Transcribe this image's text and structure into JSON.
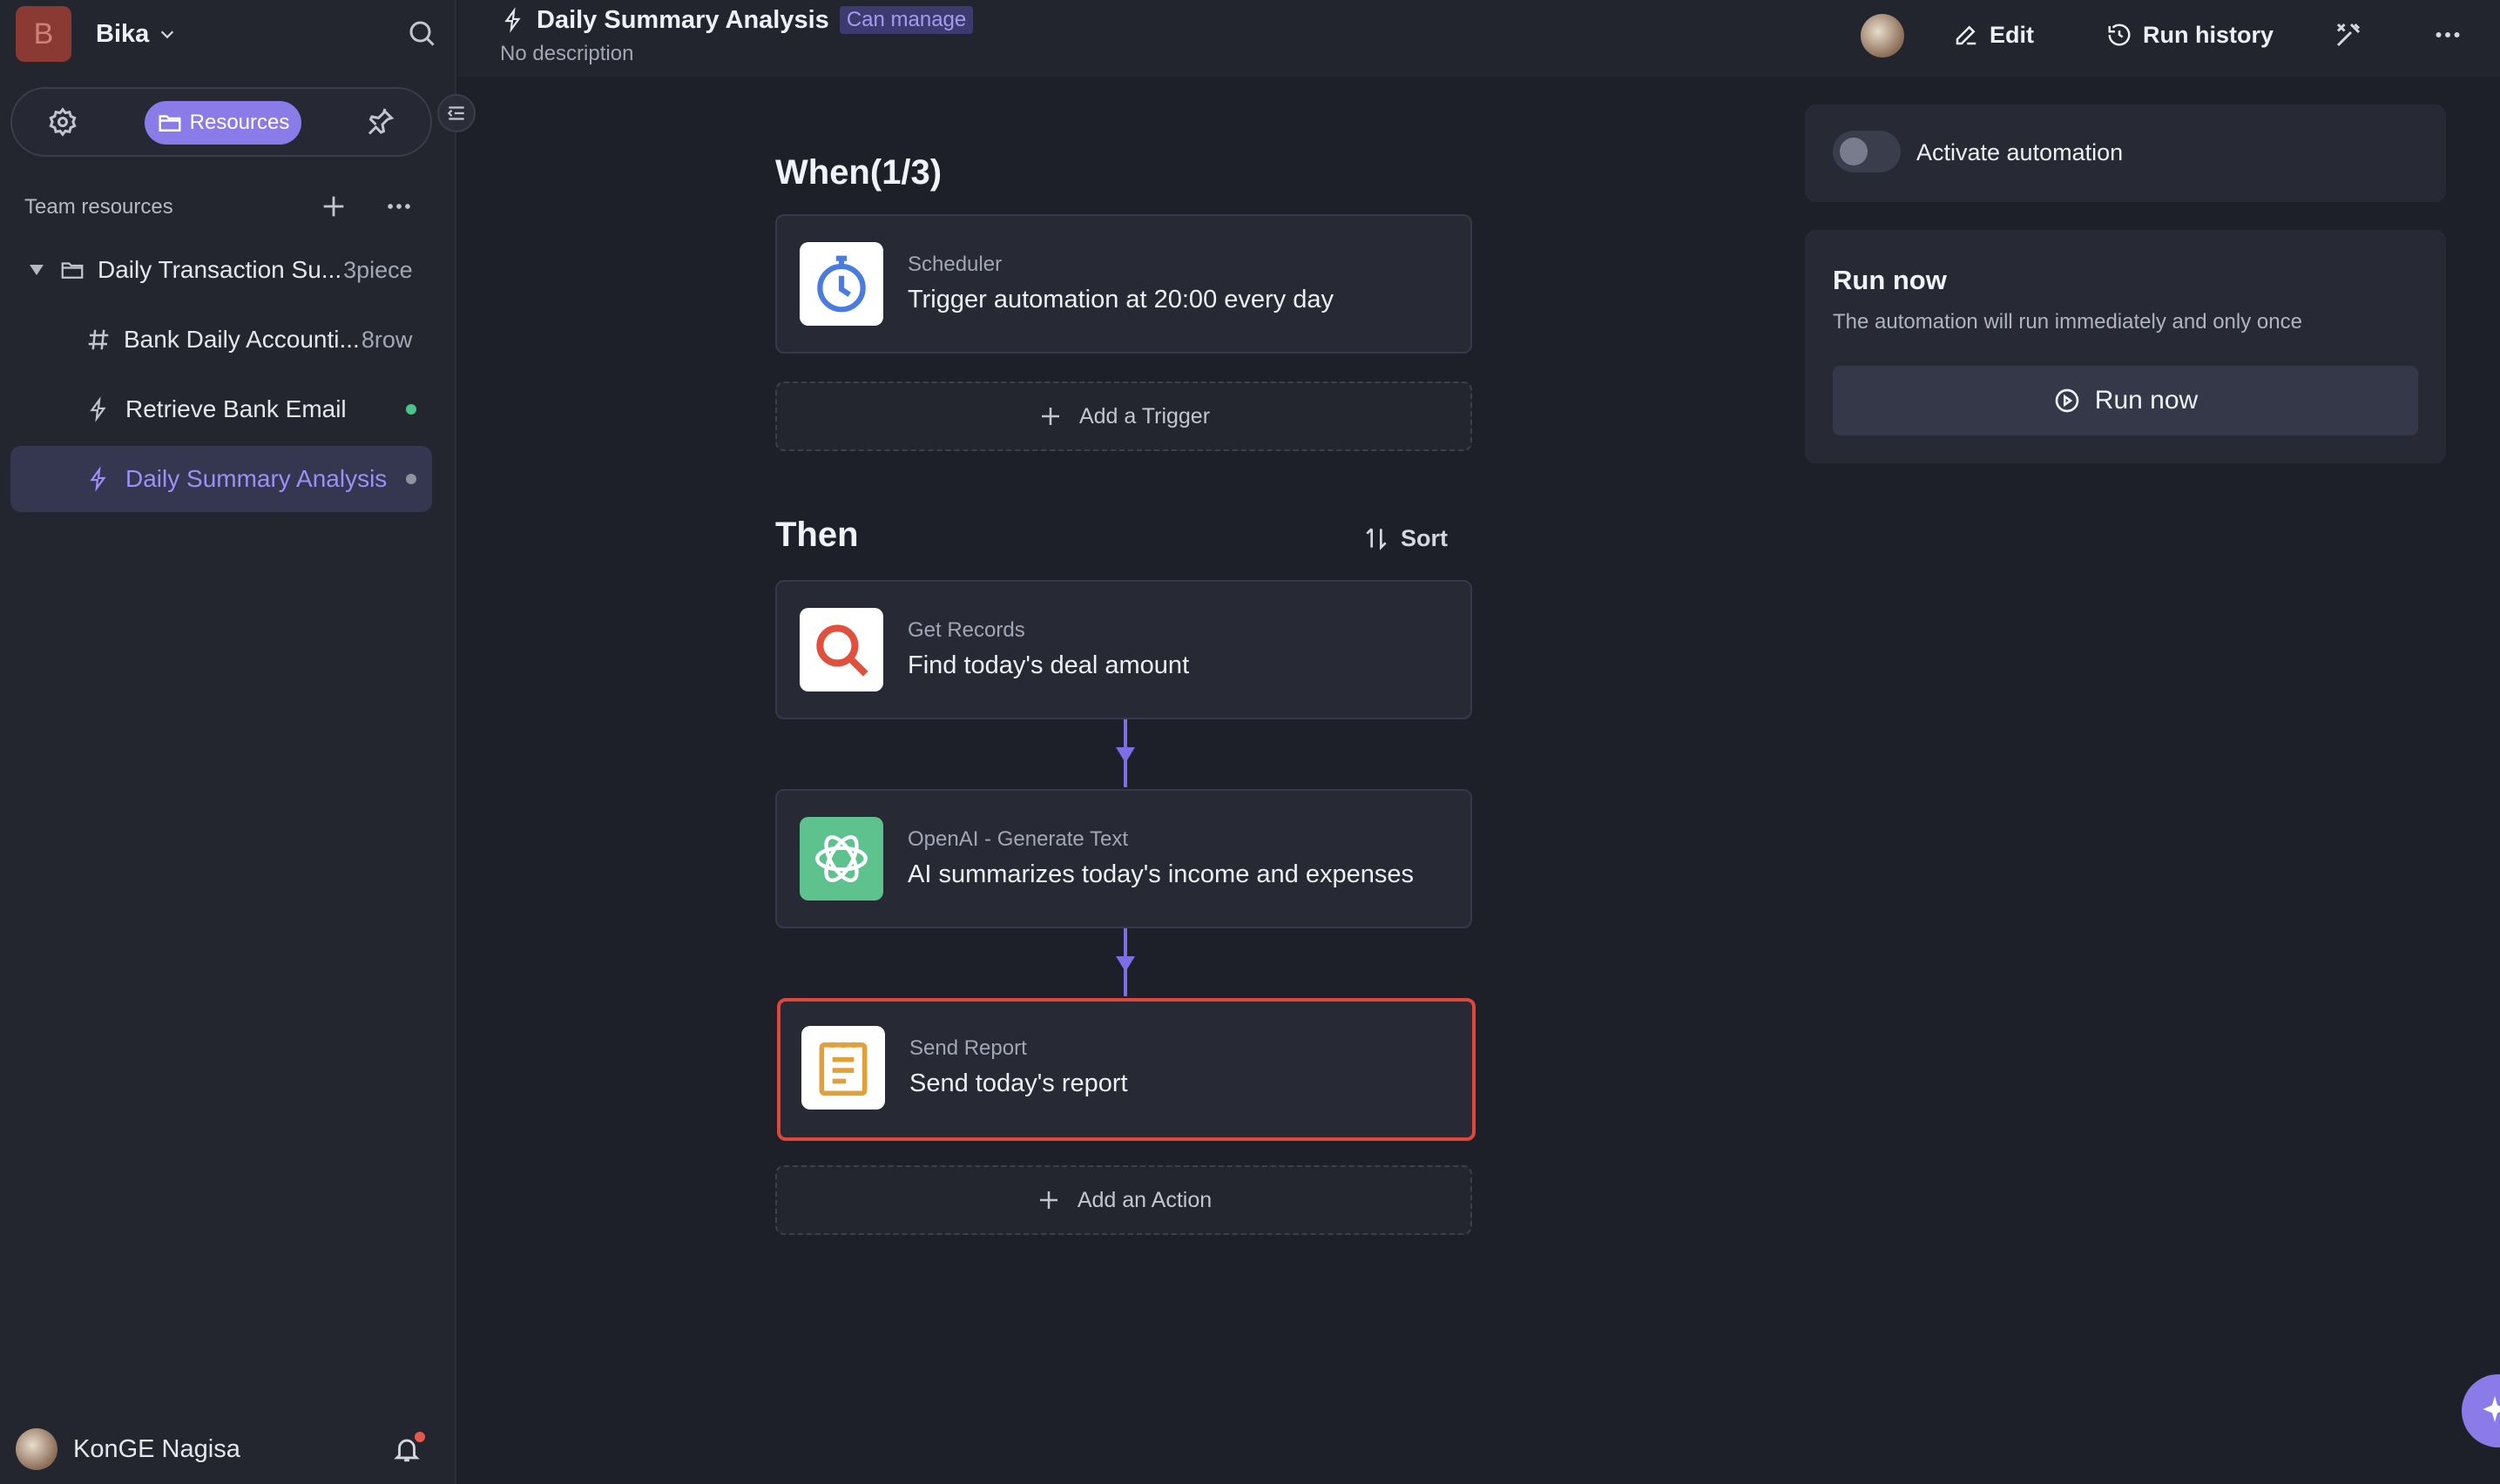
{
  "sidebar": {
    "workspace": {
      "initial": "B",
      "name": "Bika"
    },
    "tabs": {
      "active_label": "Resources"
    },
    "section_title": "Team resources",
    "tree": [
      {
        "label": "Daily Transaction Su...",
        "meta": "3piece",
        "type": "folder"
      },
      {
        "label": "Bank Daily Accounti...",
        "meta": "8row",
        "type": "table"
      },
      {
        "label": "Retrieve Bank Email",
        "meta": "",
        "type": "automation",
        "status": "active"
      },
      {
        "label": "Daily Summary Analysis",
        "meta": "",
        "type": "automation",
        "status": "inactive",
        "selected": true
      }
    ],
    "user": {
      "name": "KonGE Nagisa"
    }
  },
  "header": {
    "title": "Daily Summary Analysis",
    "permission": "Can manage",
    "description": "No description",
    "edit_label": "Edit",
    "run_history_label": "Run history"
  },
  "automation": {
    "when_title": "When(1/3)",
    "trigger": {
      "kind": "Scheduler",
      "text": "Trigger automation at 20:00 every day",
      "icon": "stopwatch-icon"
    },
    "add_trigger_label": "Add a Trigger",
    "then_title": "Then",
    "sort_label": "Sort",
    "actions": [
      {
        "kind": "Get Records",
        "text": "Find today's deal amount",
        "icon": "magnifier-icon"
      },
      {
        "kind": "OpenAI - Generate Text",
        "text": "AI summarizes today's income and expenses",
        "icon": "openai-icon"
      },
      {
        "kind": "Send Report",
        "text": "Send today's report",
        "icon": "report-icon"
      }
    ],
    "add_action_label": "Add an Action"
  },
  "right_panel": {
    "activate_label": "Activate automation",
    "activated": false,
    "run_now_title": "Run now",
    "run_now_subtitle": "The automation will run immediately and only once",
    "run_now_button": "Run now"
  },
  "colors": {
    "accent": "#8a7be8",
    "highlight_border": "#e0463c",
    "active_dot": "#4cc38a"
  }
}
